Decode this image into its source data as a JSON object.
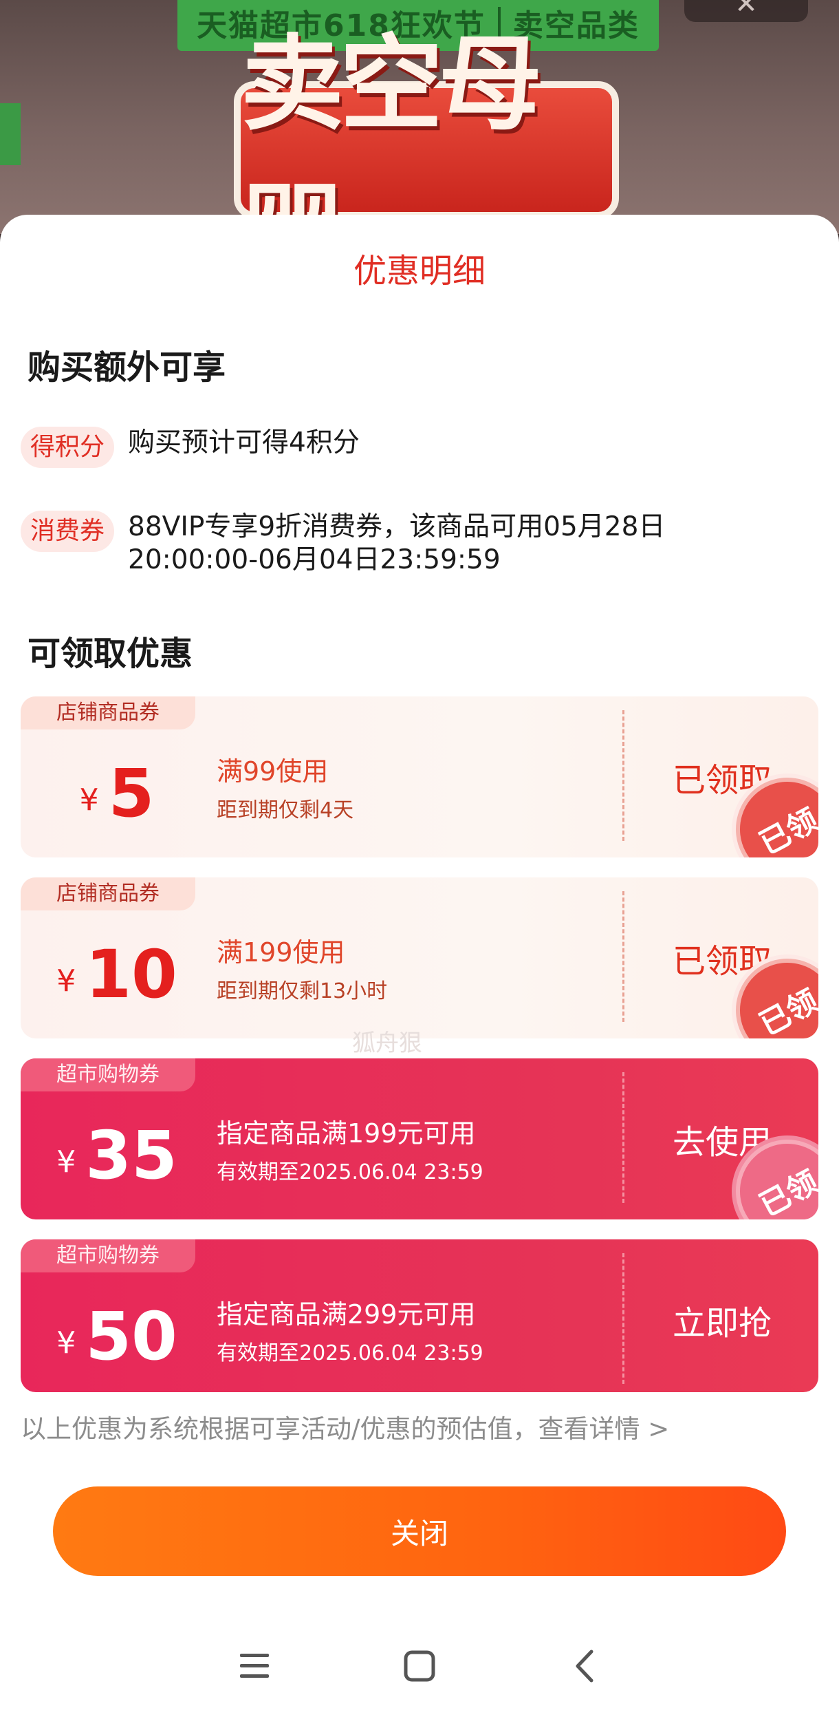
{
  "background": {
    "banner_left": "天猫超市618狂欢节",
    "banner_right": "卖空品类",
    "headline": "卖空母婴",
    "close_symbol": "✕"
  },
  "sheet": {
    "title": "优惠明细",
    "perks_title": "购买额外可享",
    "perks": [
      {
        "tag": "得积分",
        "text": "购买预计可得4积分"
      },
      {
        "tag": "消费券",
        "text": "88VIP专享9折消费券，该商品可用05月28日20:00:00-06月04日23:59:59"
      }
    ],
    "coupons_title": "可领取优惠",
    "coupons": [
      {
        "tag": "店铺商品券",
        "currency": "¥",
        "amount": "5",
        "condition": "满99使用",
        "note": "距到期仅剩4天",
        "action": "已领取",
        "stamp": "已领",
        "style": "light"
      },
      {
        "tag": "店铺商品券",
        "currency": "¥",
        "amount": "10",
        "condition": "满199使用",
        "note": "距到期仅剩13小时",
        "action": "已领取",
        "stamp": "已领",
        "style": "light"
      },
      {
        "tag": "超市购物券",
        "currency": "¥",
        "amount": "35",
        "condition": "指定商品满199元可用",
        "note": "有效期至2025.06.04 23:59",
        "action": "去使用",
        "stamp": "已领",
        "style": "red"
      },
      {
        "tag": "超市购物券",
        "currency": "¥",
        "amount": "50",
        "condition": "指定商品满299元可用",
        "note": "有效期至2025.06.04 23:59",
        "action": "立即抢",
        "style": "red"
      }
    ],
    "watermark": "狐舟狠",
    "footnote": "以上优惠为系统根据可享活动/优惠的预估值，查看详情 >",
    "close_label": "关闭"
  },
  "colors": {
    "accent_red": "#e02e24",
    "coupon_red": "#e8275a",
    "close_orange": "#ff6a10"
  },
  "navbar": {
    "icons": [
      "menu-icon",
      "home-icon",
      "back-icon"
    ]
  }
}
